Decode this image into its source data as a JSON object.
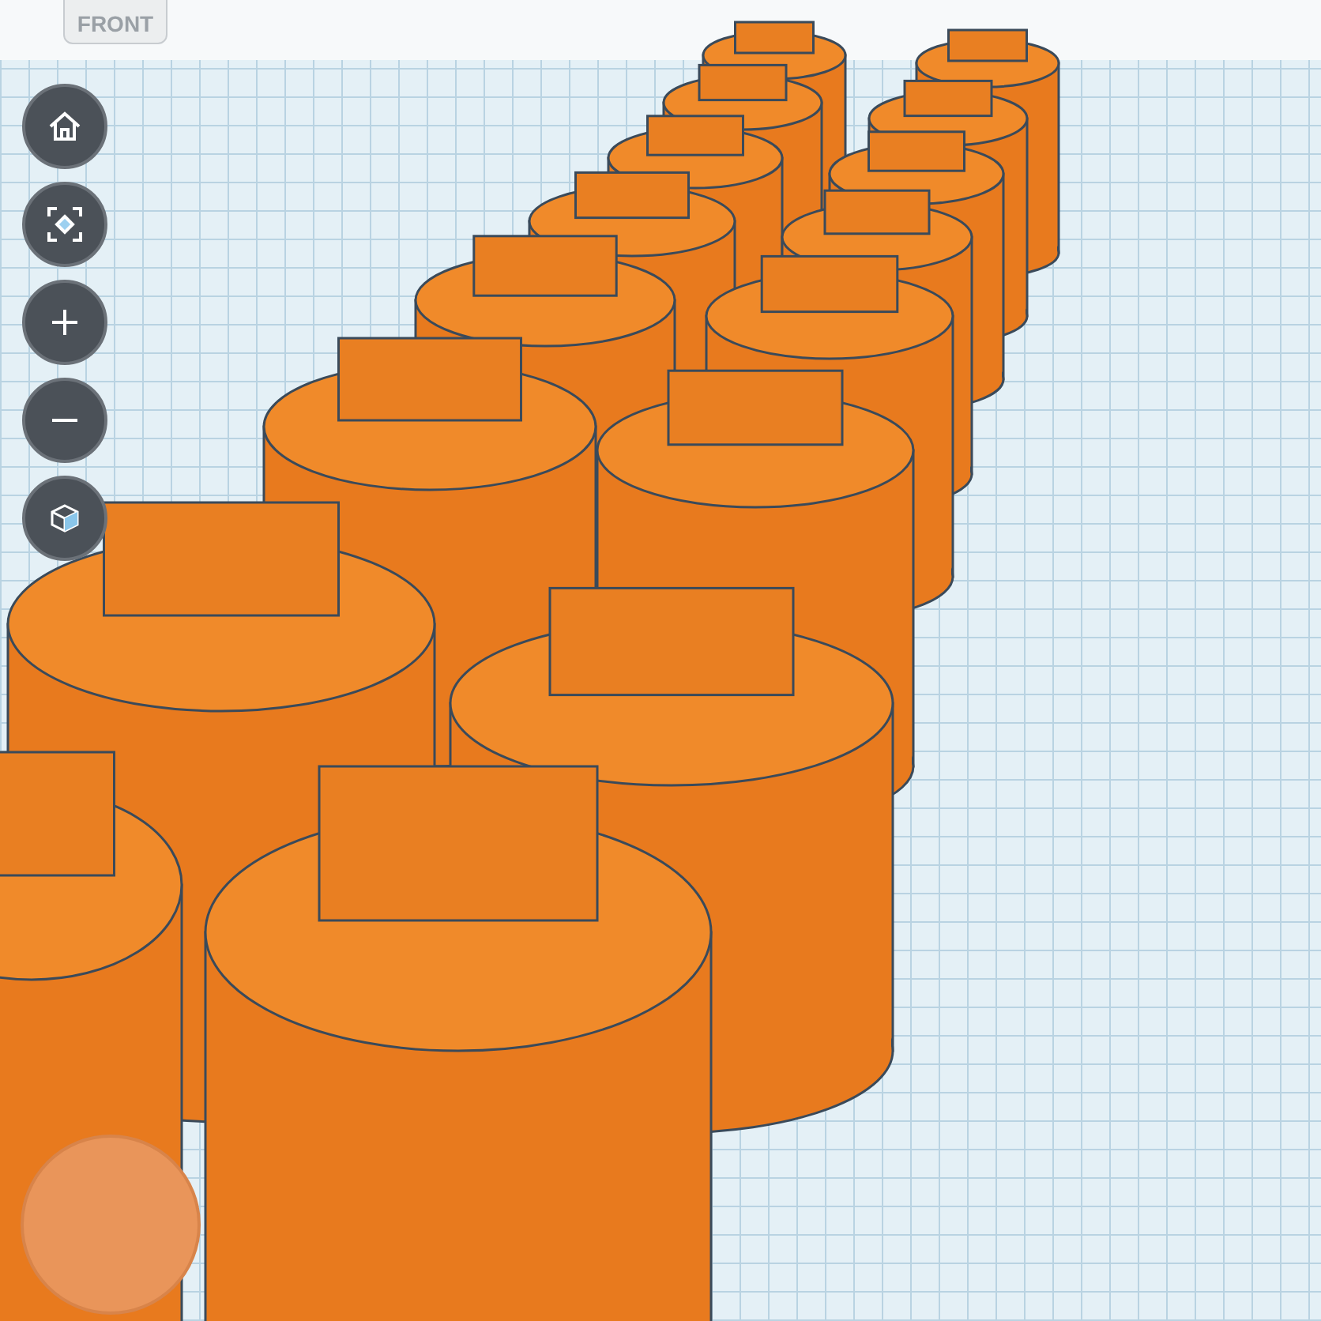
{
  "view_cube": {
    "face_label": "FRONT"
  },
  "view_controls": [
    {
      "kind": "home"
    },
    {
      "kind": "fit"
    },
    {
      "kind": "zoom_in"
    },
    {
      "kind": "zoom_out"
    },
    {
      "kind": "projection"
    }
  ]
}
